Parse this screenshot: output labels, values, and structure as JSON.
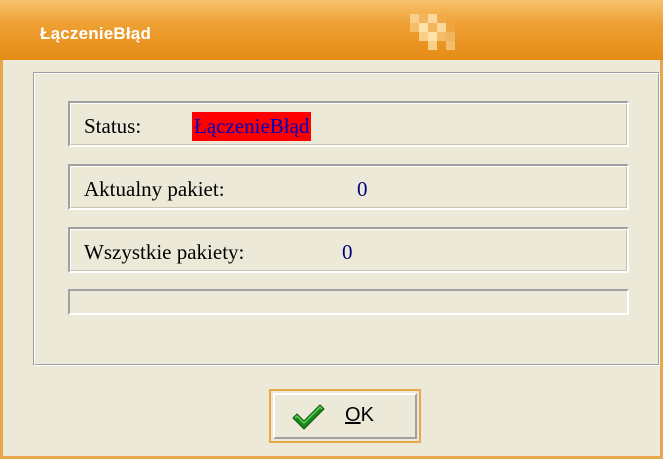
{
  "window": {
    "title": "ŁączenieBłąd"
  },
  "status": {
    "label": "Status:",
    "value": "ŁączenieBłąd",
    "value_bg_color": "#ff0000",
    "value_text_color": "#0000c0"
  },
  "current_packet": {
    "label": "Aktualny pakiet:",
    "value": "0"
  },
  "all_packets": {
    "label": "Wszystkie pakiety:",
    "value": "0"
  },
  "progress": {
    "percent": 0
  },
  "ok_button": {
    "accel": "O",
    "rest": "K",
    "icon": "checkmark-icon"
  },
  "colors": {
    "title_bar": "#e58b16",
    "frame_border": "#e8a64a",
    "face": "#ece9d8",
    "value_text": "#000080"
  }
}
